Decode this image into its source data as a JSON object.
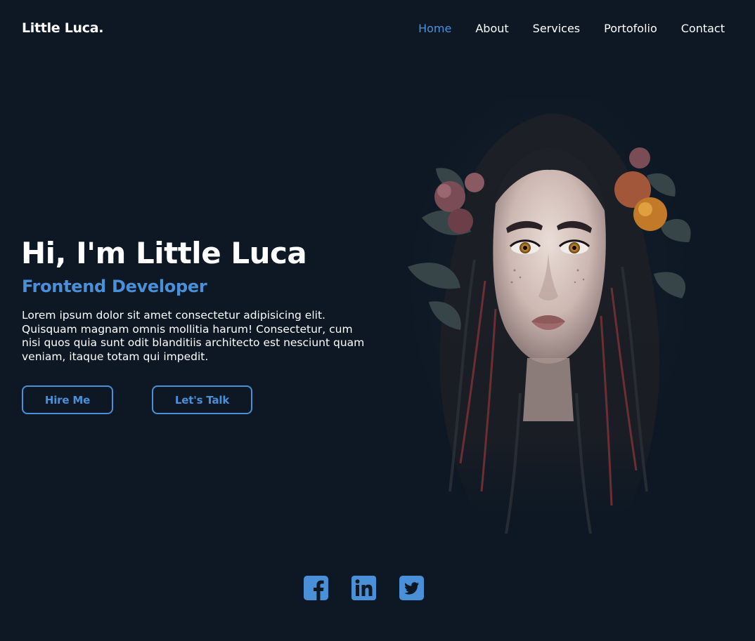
{
  "header": {
    "logo": "Little Luca.",
    "nav": [
      {
        "label": "Home",
        "active": true
      },
      {
        "label": "About",
        "active": false
      },
      {
        "label": "Services",
        "active": false
      },
      {
        "label": "Portofolio",
        "active": false
      },
      {
        "label": "Contact",
        "active": false
      }
    ]
  },
  "hero": {
    "title": "Hi, I'm Little Luca",
    "subtitle": "Frontend Developer",
    "description": "Lorem ipsum dolor sit amet consectetur adipisicing elit. Quisquam magnam omnis mollitia harum! Consectetur, cum nisi quos quia sunt odit blanditiis architecto est nesciunt quam veniam, itaque totam qui impedit.",
    "buttons": {
      "hire": "Hire Me",
      "talk": "Let's Talk"
    },
    "portrait_icon": "illustrated-woman-portrait"
  },
  "socials": [
    {
      "icon": "facebook-icon"
    },
    {
      "icon": "linkedin-icon"
    },
    {
      "icon": "twitter-icon"
    }
  ],
  "colors": {
    "background": "#0d1824",
    "accent": "#4a90d9",
    "text": "#ffffff"
  }
}
